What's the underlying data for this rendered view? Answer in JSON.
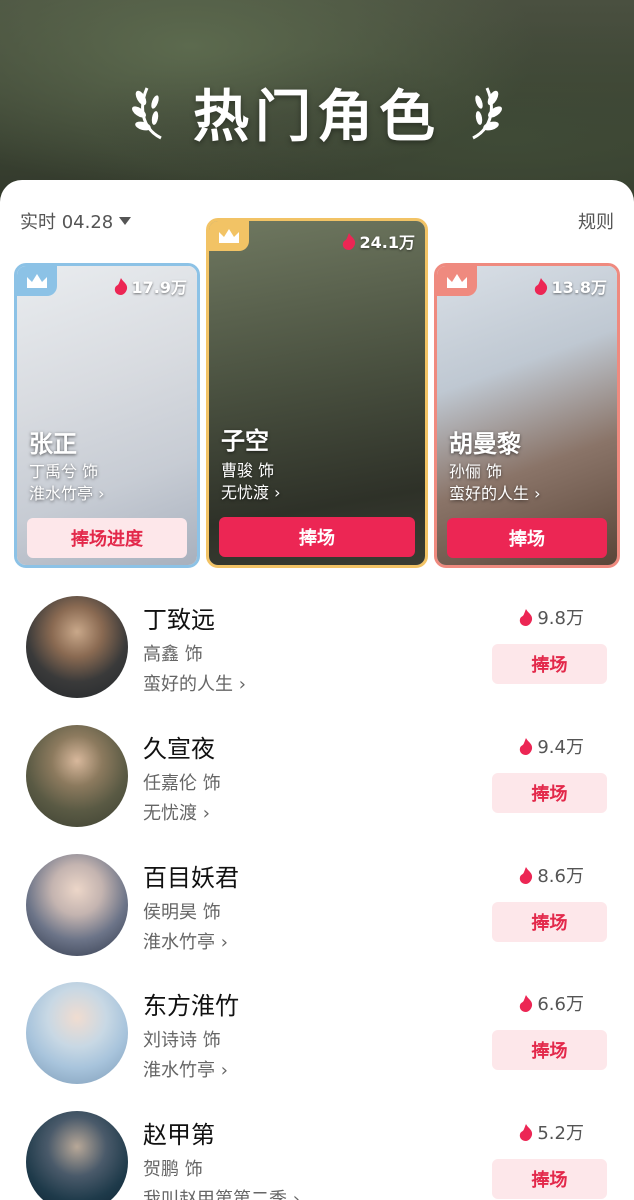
{
  "header": {
    "title": "热门角色"
  },
  "toolbar": {
    "date_label": "实时 04.28",
    "rules_label": "规则"
  },
  "top3": [
    {
      "character": "张正",
      "actor": "丁禹兮 饰",
      "drama": "淮水竹亭 ›",
      "heat": "17.9万",
      "button": "捧场进度"
    },
    {
      "character": "子空",
      "actor": "曹骏 饰",
      "drama": "无忧渡 ›",
      "heat": "24.1万",
      "button": "捧场"
    },
    {
      "character": "胡曼黎",
      "actor": "孙俪 饰",
      "drama": "蛮好的人生 ›",
      "heat": "13.8万",
      "button": "捧场"
    }
  ],
  "ranking": [
    {
      "character": "丁致远",
      "actor": "高鑫 饰",
      "drama": "蛮好的人生 ›",
      "heat": "9.8万",
      "button": "捧场"
    },
    {
      "character": "久宣夜",
      "actor": "任嘉伦 饰",
      "drama": "无忧渡 ›",
      "heat": "9.4万",
      "button": "捧场"
    },
    {
      "character": "百目妖君",
      "actor": "侯明昊 饰",
      "drama": "淮水竹亭 ›",
      "heat": "8.6万",
      "button": "捧场"
    },
    {
      "character": "东方淮竹",
      "actor": "刘诗诗 饰",
      "drama": "淮水竹亭 ›",
      "heat": "6.6万",
      "button": "捧场"
    },
    {
      "character": "赵甲第",
      "actor": "贺鹏 饰",
      "drama": "我叫赵甲第第二季 ›",
      "heat": "5.2万",
      "button": "捧场"
    }
  ],
  "colors": {
    "accent": "#ec2654",
    "soft_accent": "#fde7ea",
    "flame": "#ec2654"
  },
  "icons": {
    "crown": "crown-icon",
    "flame": "flame-icon",
    "dropdown": "triangle-down-icon",
    "laurel": "laurel-icon"
  }
}
